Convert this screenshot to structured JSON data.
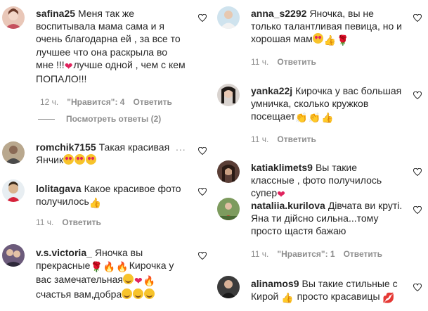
{
  "left": {
    "c1": {
      "username": "safina25",
      "text": "Меня так же воспитывала мама сама и я очень благодарна ей , за все то лучшее что она раскрыла во мне !!!",
      "text_after_heart": "лучше одной , чем с кем ПОПАЛО!!!",
      "time": "12 ч.",
      "likes": "\"Нравится\": 4",
      "reply": "Ответить",
      "view_replies": "Посмотреть ответы (2)"
    },
    "c2": {
      "username": "romchik7155",
      "text": "Такая красивая Янчик",
      "more": "..."
    },
    "c3": {
      "username": "lolitagava",
      "text": "Какое красивое фото получилось",
      "time": "11 ч.",
      "reply": "Ответить"
    },
    "c4": {
      "username": "v.s.victoria_",
      "text": "Яночка вы прекрасные",
      "text2": "Кирочка у вас замечательная",
      "text3": "счастья вам,добра"
    }
  },
  "right": {
    "c1": {
      "username": "anna_s2292",
      "text": "Яночка, вы не только талантливая певица, но и хорошая мам",
      "time": "11 ч.",
      "reply": "Ответить"
    },
    "c2": {
      "username": "yanka22j",
      "text": "Кирочка у вас большая умничка, сколько кружков посещает",
      "time": "11 ч.",
      "reply": "Ответить"
    },
    "c3": {
      "username": "katiaklimets9",
      "text": "Вы такие классные , фото получилось супер"
    },
    "c4": {
      "username": "nataliia.kurilova",
      "text": "Дівчата ви круті. Яна ти дійсно сильна...тому просто щастя бажаю",
      "time": "11 ч.",
      "likes": "\"Нравится\": 1",
      "reply": "Ответить"
    },
    "c5": {
      "username": "alinamos9",
      "text": "Вы такие стильные с Кирой",
      "text2": "просто красавицы"
    }
  },
  "icons": {
    "like": "heart-outline-icon",
    "more": "more-horizontal-icon"
  },
  "colors": {
    "text": "#262626",
    "muted": "#8e8e8e",
    "background": "#ffffff"
  }
}
